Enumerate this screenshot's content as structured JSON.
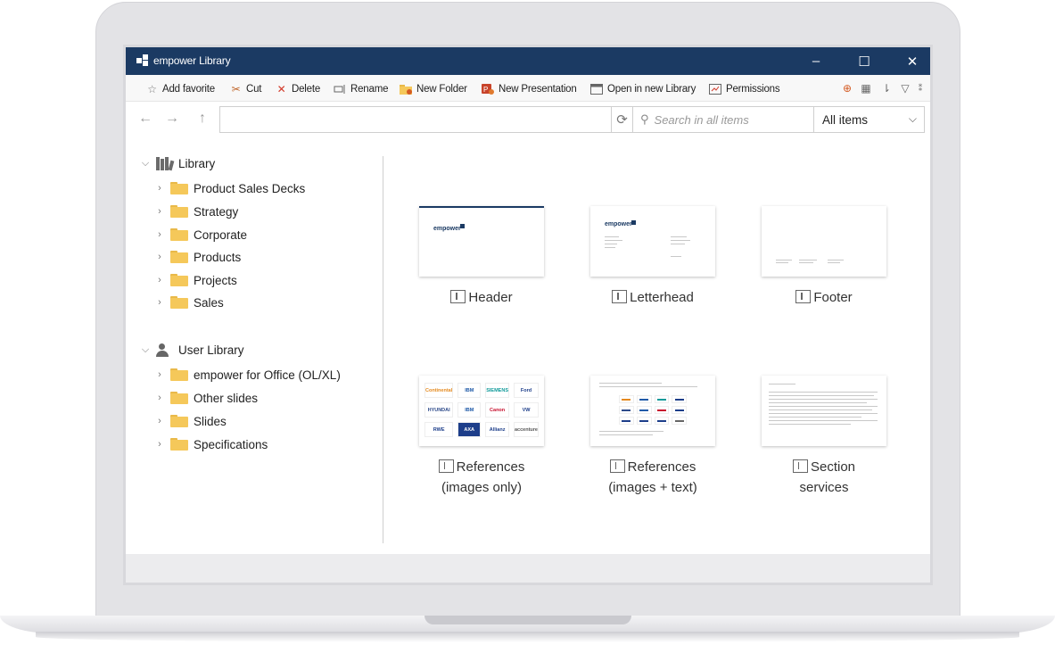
{
  "window": {
    "title": "empower Library",
    "controls": {
      "minimize": "–",
      "maximize": "☐",
      "close": "✕"
    }
  },
  "toolbar": {
    "items": [
      {
        "label": "Add favorite",
        "icon": "star-icon"
      },
      {
        "label": "Cut",
        "icon": "scissors-icon"
      },
      {
        "label": "Delete",
        "icon": "delete-x-icon",
        "color": "#d23a2a"
      },
      {
        "label": "Rename",
        "icon": "rename-icon"
      },
      {
        "label": "New Folder",
        "icon": "new-folder-icon"
      },
      {
        "label": "New Presentation",
        "icon": "new-presentation-icon"
      },
      {
        "label": "Open in new Library",
        "icon": "open-window-icon"
      },
      {
        "label": "Permissions",
        "icon": "permissions-icon"
      }
    ],
    "right_icons": [
      "globe-icon",
      "grid-view-icon",
      "sort-icon",
      "filter-icon",
      "more-icon"
    ]
  },
  "navigation": {
    "back": "←",
    "forward": "→",
    "up": "↑",
    "path_value": "",
    "search_placeholder": "Search in all items",
    "filter_selected": "All items"
  },
  "tree": {
    "library": {
      "label": "Library",
      "children": [
        "Product Sales Decks",
        "Strategy",
        "Corporate",
        "Products",
        "Projects",
        "Sales"
      ]
    },
    "user_library": {
      "label": "User Library",
      "children": [
        "empower for Office (OL/XL)",
        "Other slides",
        "Slides",
        "Specifications"
      ]
    }
  },
  "tiles": [
    {
      "line1": "Header",
      "line2": ""
    },
    {
      "line1": "Letterhead",
      "line2": ""
    },
    {
      "line1": "Footer",
      "line2": ""
    },
    {
      "line1": "References",
      "line2": "(images only)"
    },
    {
      "line1": "References",
      "line2": "(images + text)"
    },
    {
      "line1": "Section",
      "line2": "services"
    }
  ],
  "thumbnails": {
    "brand": "empower",
    "logos": [
      "Continental",
      "IBM",
      "SIEMENS",
      "Ford",
      "HYUNDAI",
      "IBM",
      "Canon",
      "VW",
      "RWE",
      "AXA",
      "Allianz",
      "accenture"
    ]
  },
  "colors": {
    "titlebar": "#1b3a63",
    "folder": "#f5c85a",
    "delete": "#d23a2a"
  }
}
